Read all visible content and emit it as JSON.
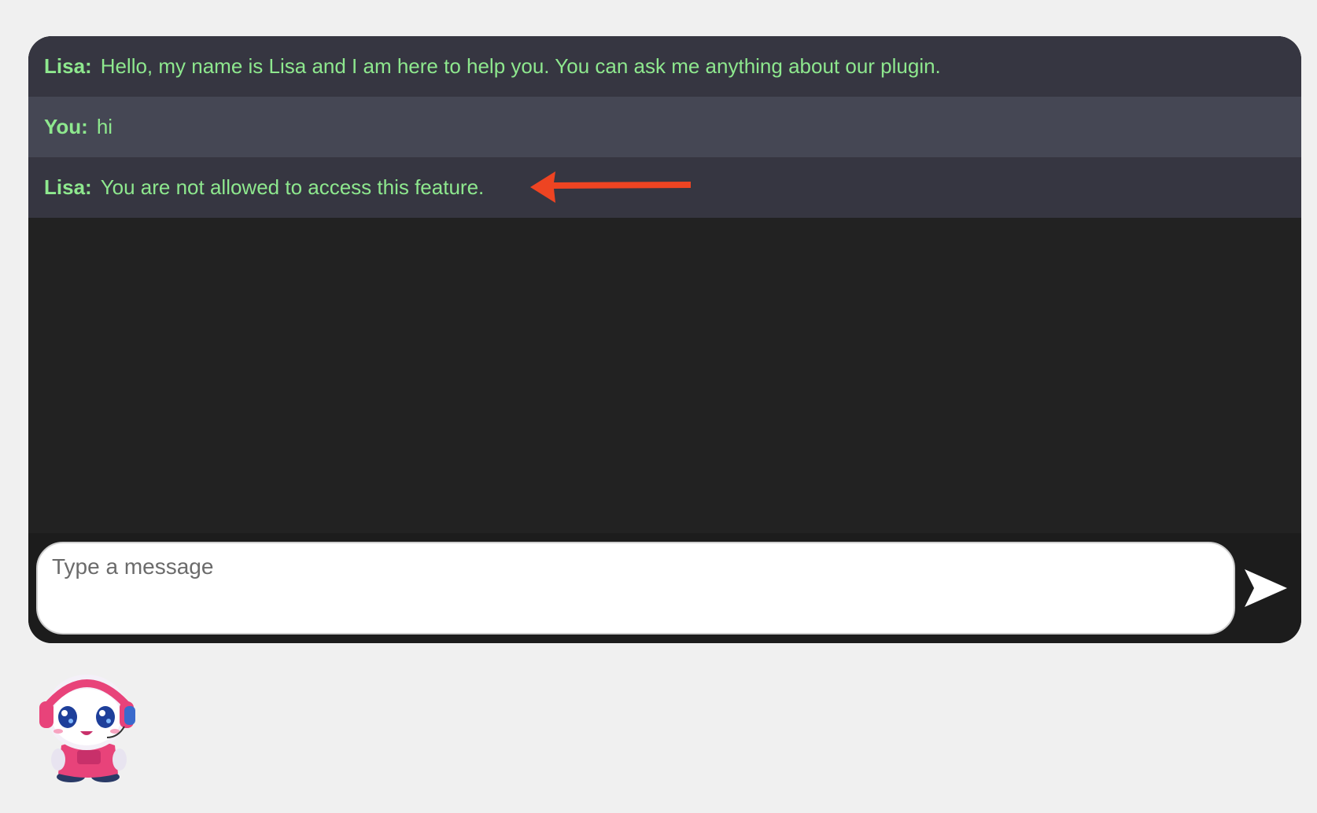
{
  "chat": {
    "messages": [
      {
        "sender": "Lisa:",
        "text": "Hello, my name is Lisa and I am here to help you. You can ask me anything about our plugin."
      },
      {
        "sender": "You:",
        "text": "hi"
      },
      {
        "sender": "Lisa:",
        "text": "You are not allowed to access this feature."
      }
    ]
  },
  "input": {
    "placeholder": "Type a message",
    "value": ""
  },
  "icons": {
    "send": "send-arrow-icon",
    "annotation": "red-arrow-left-icon",
    "mascot": "robot-mascot-icon"
  },
  "colors": {
    "message_text": "#8ee88e",
    "bot_row_bg": "#363641",
    "user_row_bg": "#454754",
    "chat_bg": "#222222",
    "annotation_arrow": "#ee4422"
  }
}
